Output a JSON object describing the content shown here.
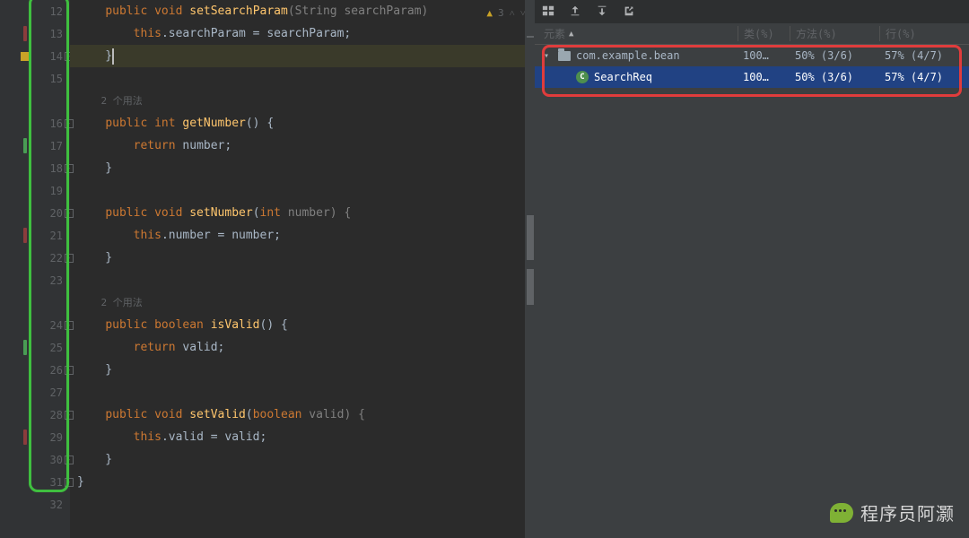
{
  "editor": {
    "inspection": {
      "warn_count": "3"
    },
    "lines": [
      {
        "n": "12",
        "marker": "",
        "fold": "",
        "html": "    public void setSearchParam(String searchParam)",
        "tokens": [
          [
            "    ",
            "p"
          ],
          [
            "public",
            "kw"
          ],
          [
            " ",
            "p"
          ],
          [
            "void",
            "kw"
          ],
          [
            " ",
            "p"
          ],
          [
            "setSearchParam",
            "fn"
          ],
          [
            "(String searchParam)",
            "dim"
          ]
        ]
      },
      {
        "n": "13",
        "marker": "red",
        "fold": "",
        "tokens": [
          [
            "        ",
            "p"
          ],
          [
            "this",
            "kw"
          ],
          [
            ".",
            "p"
          ],
          [
            "searchParam = searchParam;",
            "p"
          ]
        ]
      },
      {
        "n": "14",
        "marker": "yellow",
        "fold": "end",
        "tokens": [
          [
            "    }",
            "p"
          ]
        ],
        "cursor": true
      },
      {
        "n": "15",
        "marker": "",
        "fold": "",
        "tokens": [
          [
            "",
            "p"
          ]
        ]
      },
      {
        "n": "",
        "marker": "",
        "fold": "",
        "usage": "2 个用法"
      },
      {
        "n": "16",
        "marker": "",
        "fold": "start",
        "tokens": [
          [
            "    ",
            "p"
          ],
          [
            "public int ",
            "kw"
          ],
          [
            "getNumber",
            "fn"
          ],
          [
            "() {",
            "p"
          ]
        ]
      },
      {
        "n": "17",
        "marker": "green",
        "fold": "",
        "tokens": [
          [
            "        ",
            "p"
          ],
          [
            "return ",
            "kw"
          ],
          [
            "number;",
            "p"
          ]
        ]
      },
      {
        "n": "18",
        "marker": "",
        "fold": "end",
        "tokens": [
          [
            "    }",
            "p"
          ]
        ]
      },
      {
        "n": "19",
        "marker": "",
        "fold": "",
        "tokens": [
          [
            "",
            "p"
          ]
        ]
      },
      {
        "n": "20",
        "marker": "",
        "fold": "start",
        "tokens": [
          [
            "    ",
            "p"
          ],
          [
            "public void ",
            "kw"
          ],
          [
            "setNumber",
            "fn"
          ],
          [
            "(",
            "p"
          ],
          [
            "int",
            "kw"
          ],
          [
            " number) {",
            "dim"
          ]
        ]
      },
      {
        "n": "21",
        "marker": "red",
        "fold": "",
        "tokens": [
          [
            "        ",
            "p"
          ],
          [
            "this",
            "kw"
          ],
          [
            ".",
            "p"
          ],
          [
            "number = number;",
            "p"
          ]
        ]
      },
      {
        "n": "22",
        "marker": "",
        "fold": "end",
        "tokens": [
          [
            "    }",
            "p"
          ]
        ]
      },
      {
        "n": "23",
        "marker": "",
        "fold": "",
        "tokens": [
          [
            "",
            "p"
          ]
        ]
      },
      {
        "n": "",
        "marker": "",
        "fold": "",
        "usage": "2 个用法"
      },
      {
        "n": "24",
        "marker": "",
        "fold": "start",
        "tokens": [
          [
            "    ",
            "p"
          ],
          [
            "public boolean ",
            "kw"
          ],
          [
            "isValid",
            "fn"
          ],
          [
            "() {",
            "p"
          ]
        ]
      },
      {
        "n": "25",
        "marker": "green",
        "fold": "",
        "tokens": [
          [
            "        ",
            "p"
          ],
          [
            "return ",
            "kw"
          ],
          [
            "valid;",
            "p"
          ]
        ]
      },
      {
        "n": "26",
        "marker": "",
        "fold": "end",
        "tokens": [
          [
            "    }",
            "p"
          ]
        ]
      },
      {
        "n": "27",
        "marker": "",
        "fold": "",
        "tokens": [
          [
            "",
            "p"
          ]
        ]
      },
      {
        "n": "28",
        "marker": "",
        "fold": "start",
        "tokens": [
          [
            "    ",
            "p"
          ],
          [
            "public void ",
            "kw"
          ],
          [
            "setValid",
            "fn"
          ],
          [
            "(",
            "p"
          ],
          [
            "boolean",
            "kw"
          ],
          [
            " valid) {",
            "dim"
          ]
        ]
      },
      {
        "n": "29",
        "marker": "red",
        "fold": "",
        "tokens": [
          [
            "        ",
            "p"
          ],
          [
            "this",
            "kw"
          ],
          [
            ".",
            "p"
          ],
          [
            "valid = valid;",
            "p"
          ]
        ]
      },
      {
        "n": "30",
        "marker": "",
        "fold": "end",
        "tokens": [
          [
            "    }",
            "p"
          ]
        ]
      },
      {
        "n": "31",
        "marker": "",
        "fold": "end",
        "tokens": [
          [
            "}",
            "p"
          ]
        ]
      },
      {
        "n": "32",
        "marker": "",
        "fold": "",
        "tokens": [
          [
            "",
            "p"
          ]
        ]
      }
    ]
  },
  "coverage": {
    "headers": {
      "element": "元素",
      "class": "类(%)",
      "method": "方法(%)",
      "line": "行(%)"
    },
    "rows": [
      {
        "icon": "pkg",
        "name": "com.example.bean",
        "class": "100…",
        "method": "50% (3/6)",
        "line": "57% (4/7)",
        "indent": 0,
        "expanded": true
      },
      {
        "icon": "class",
        "letter": "C",
        "name": "SearchReq",
        "class": "100…",
        "method": "50% (3/6)",
        "line": "57% (4/7)",
        "indent": 1,
        "selected": true
      }
    ]
  },
  "watermark": "程序员阿灏"
}
